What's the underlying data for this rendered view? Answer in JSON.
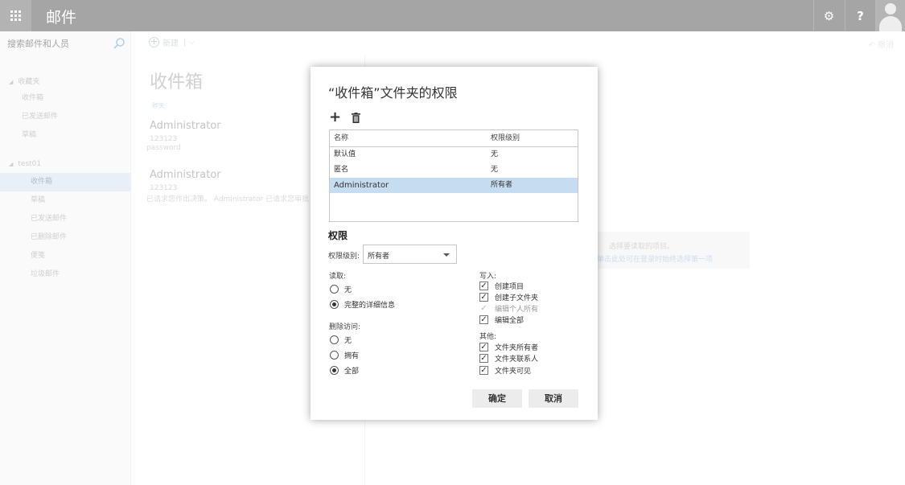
{
  "app": {
    "title": "邮件"
  },
  "topbar": {
    "settings_glyph": "⚙",
    "help_glyph": "?"
  },
  "search": {
    "placeholder": "搜索邮件和人员"
  },
  "sidebar": {
    "favorites_header": "收藏夹",
    "favorites": [
      "收件箱",
      "已发送邮件",
      "草稿"
    ],
    "account_header": "test01",
    "account_items": [
      "收件箱",
      "草稿",
      "已发送邮件",
      "已删除邮件",
      "便笺",
      "垃圾邮件"
    ],
    "active_index": 0
  },
  "toolbar": {
    "new_label": "新建",
    "undo_label": "撤消"
  },
  "mail_list": {
    "folder_title": "收件箱",
    "date_group": "昨天",
    "messages": [
      {
        "from": "Administrator",
        "subject": "123123",
        "preview": "password"
      },
      {
        "from": "Administrator",
        "subject": "123123",
        "preview": "已请求您作出决策。 Administrator 已请求您审批"
      }
    ]
  },
  "reading_pane": {
    "hint": "选择要读取的项目。",
    "link": "单击此处可在登录时始终选择第一项"
  },
  "dialog": {
    "title": "“收件箱”文件夹的权限",
    "table": {
      "col_name": "名称",
      "col_level": "权限级别",
      "rows": [
        {
          "name": "默认值",
          "level": "无"
        },
        {
          "name": "匿名",
          "level": "无"
        },
        {
          "name": "Administrator",
          "level": "所有者"
        }
      ],
      "selected_index": 2
    },
    "permissions_title": "权限",
    "level_label": "权限级别:",
    "level_value": "所有者",
    "read": {
      "label": "读取:",
      "opt_none": "无",
      "opt_full": "完整的详细信息",
      "selected": "opt_full"
    },
    "delete": {
      "label": "删除访问:",
      "opt_none": "无",
      "opt_own": "拥有",
      "opt_all": "全部",
      "selected": "opt_all"
    },
    "write": {
      "label": "写入:",
      "create_items": "创建项目",
      "create_subfolders": "创建子文件夹",
      "edit_own": "编辑个人所有",
      "edit_all": "编辑全部"
    },
    "other": {
      "label": "其他:",
      "folder_owner": "文件夹所有者",
      "folder_contact": "文件夹联系人",
      "folder_visible": "文件夹可见"
    },
    "ok_label": "确定",
    "cancel_label": "取消"
  }
}
